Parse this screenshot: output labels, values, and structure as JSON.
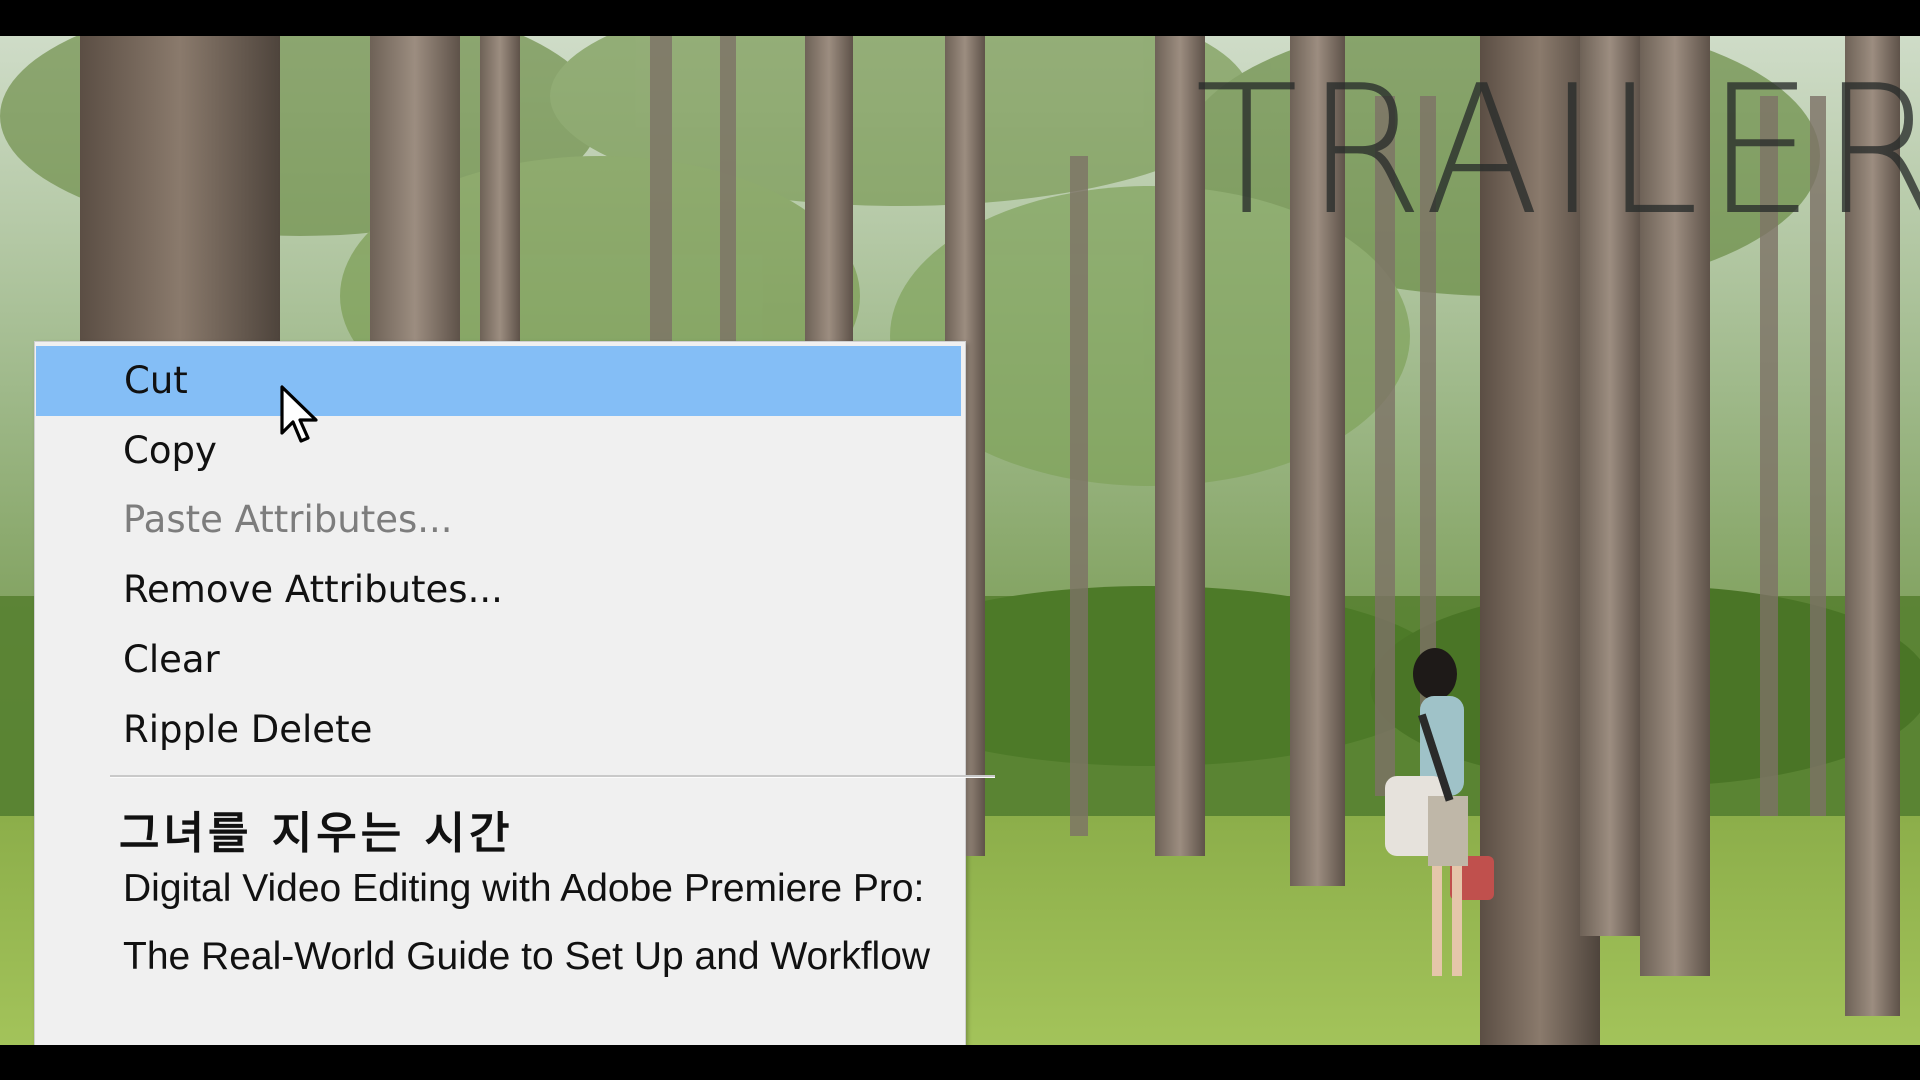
{
  "overlay": {
    "title": "TRAILER"
  },
  "context_menu": {
    "items": [
      {
        "label": "Cut",
        "state": "highlighted"
      },
      {
        "label": "Copy",
        "state": "enabled"
      },
      {
        "label": "Paste Attributes...",
        "state": "disabled"
      },
      {
        "label": "Remove Attributes...",
        "state": "enabled"
      },
      {
        "label": "Clear",
        "state": "enabled"
      },
      {
        "label": "Ripple Delete",
        "state": "enabled"
      }
    ],
    "footer": {
      "korean_title": "그녀를 지우는 시간",
      "book_title_line1": "Digital Video Editing with Adobe Premiere Pro:",
      "book_title_line2": "The Real-World Guide to Set Up and Workflow"
    }
  },
  "colors": {
    "menu_background": "#f0f0f0",
    "highlight": "#84bef6",
    "disabled_text": "#7d7d7d",
    "letterbox": "#000000"
  },
  "icons": [
    "mouse-pointer-icon"
  ]
}
